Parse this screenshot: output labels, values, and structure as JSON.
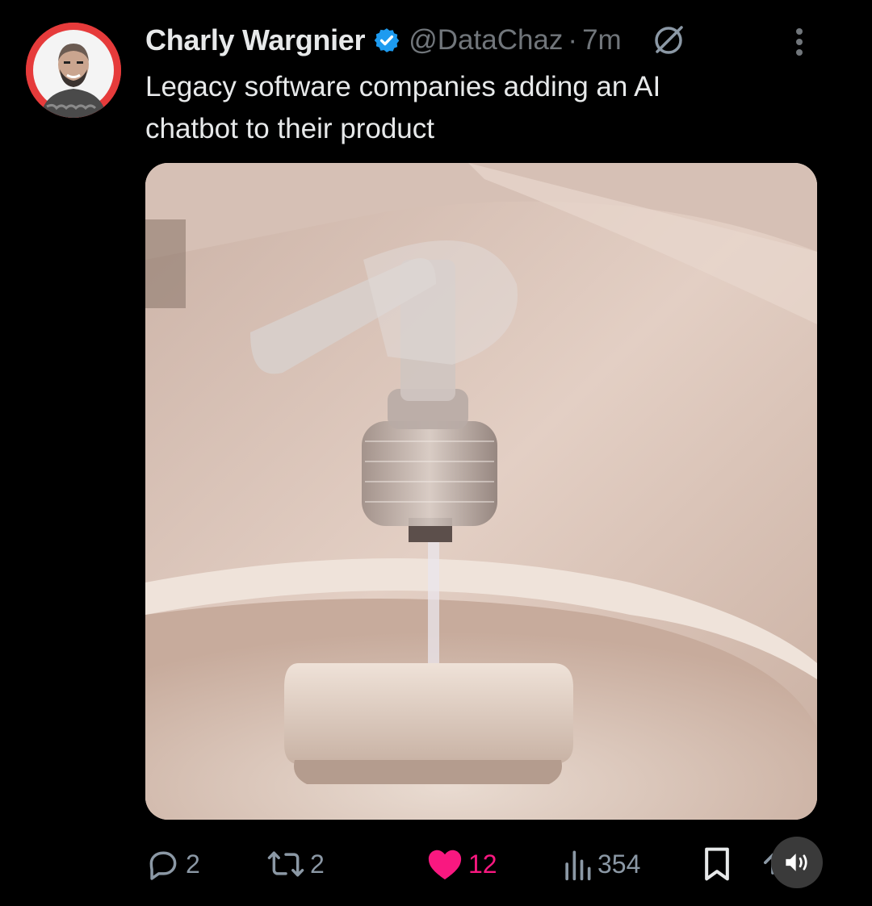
{
  "author": {
    "name": "Charly Wargnier",
    "handle": "@DataChaz",
    "separator": "·",
    "time": "7m",
    "verified": true,
    "avatar_bg": "#e63b3b"
  },
  "tweet": {
    "text": "Legacy software companies adding an AI\nchatbot to their product"
  },
  "media": {
    "description_icon": "photo-soap-dispenser-pump-dripping-on-soap-bar"
  },
  "actions": {
    "replies": "2",
    "reposts": "2",
    "likes": "12",
    "views": "354",
    "liked": true
  },
  "icons": {
    "reply": "reply-icon",
    "repost": "repost-icon",
    "like": "heart-icon",
    "views": "views-icon",
    "bookmark": "bookmark-icon",
    "share": "share-icon",
    "sound": "speaker-icon",
    "grok": "grok-icon",
    "more": "more-vertical-icon"
  },
  "colors": {
    "background": "#000000",
    "text": "#e7e9ea",
    "secondary": "#71767b",
    "like": "#f91880",
    "verified": "#1d9bf0"
  }
}
